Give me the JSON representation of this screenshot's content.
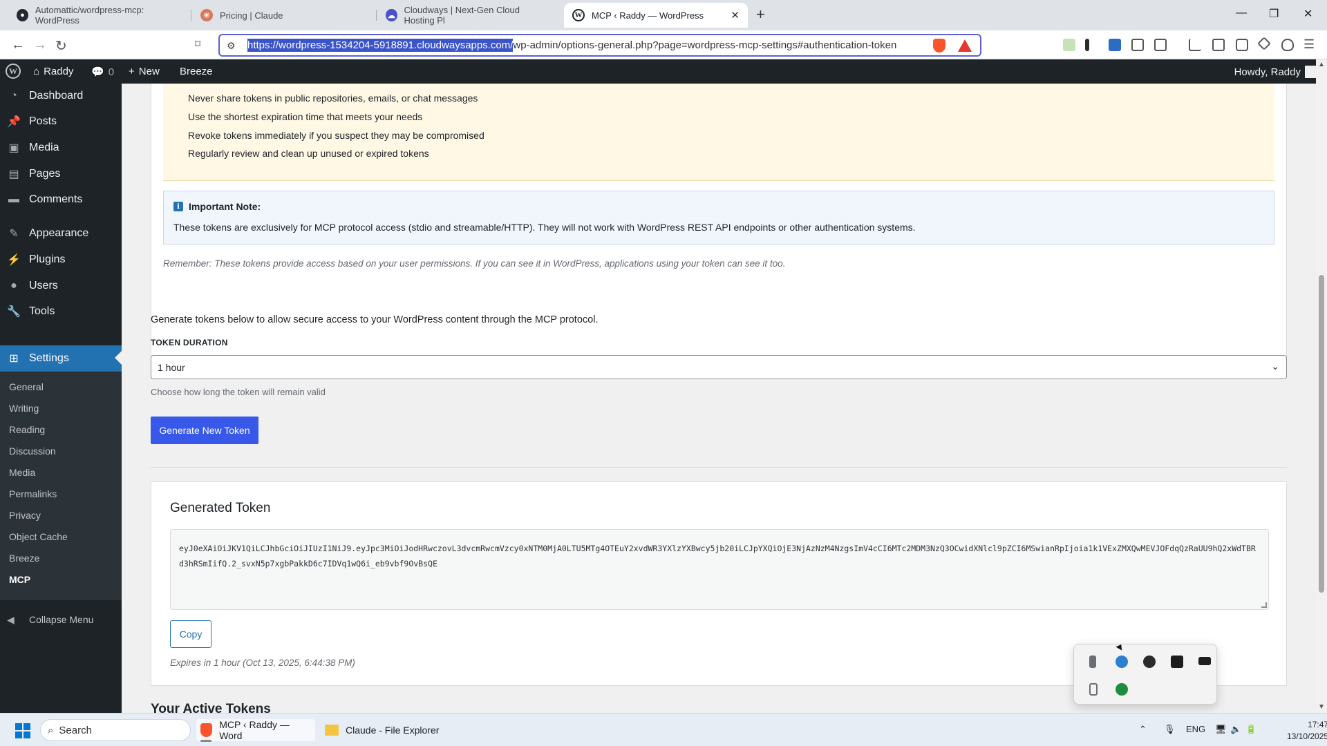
{
  "browser": {
    "tabs": [
      {
        "label": "Automattic/wordpress-mcp: WordPress",
        "icon": "github-icon",
        "active": false
      },
      {
        "label": "Pricing | Claude",
        "icon": "claude-icon",
        "active": false
      },
      {
        "label": "Cloudways | Next-Gen Cloud Hosting Pl",
        "icon": "cloudways-icon",
        "active": false
      },
      {
        "label": "MCP ‹ Raddy — WordPress",
        "icon": "wordpress-icon",
        "active": true
      }
    ],
    "url_host": "https://wordpress-1534204-5918891.cloudwaysapps.com/",
    "url_rest": "wp-admin/options-general.php?page=wordpress-mcp-settings#authentication-token"
  },
  "adminbar": {
    "site_name": "Raddy",
    "comments_count": "0",
    "new_label": "New",
    "breeze_label": "Breeze",
    "howdy": "Howdy, Raddy"
  },
  "sidebar": {
    "items": [
      {
        "label": "Dashboard",
        "icon": "dashboard-icon"
      },
      {
        "label": "Posts",
        "icon": "pin-icon"
      },
      {
        "label": "Media",
        "icon": "media-icon"
      },
      {
        "label": "Pages",
        "icon": "pages-icon"
      },
      {
        "label": "Comments",
        "icon": "comments-icon"
      },
      {
        "label": "Appearance",
        "icon": "brush-icon"
      },
      {
        "label": "Plugins",
        "icon": "plug-icon"
      },
      {
        "label": "Users",
        "icon": "user-icon"
      },
      {
        "label": "Tools",
        "icon": "wrench-icon"
      },
      {
        "label": "Settings",
        "icon": "settings-icon"
      }
    ],
    "submenu": [
      "General",
      "Writing",
      "Reading",
      "Discussion",
      "Media",
      "Permalinks",
      "Privacy",
      "Object Cache",
      "Breeze",
      "MCP"
    ],
    "collapse_label": "Collapse Menu"
  },
  "security": {
    "tips": [
      "Never share tokens in public repositories, emails, or chat messages",
      "Use the shortest expiration time that meets your needs",
      "Revoke tokens immediately if you suspect they may be compromised",
      "Regularly review and clean up unused or expired tokens"
    ],
    "note_title": "Important Note:",
    "note_text": "These tokens are exclusively for MCP protocol access (stdio and streamable/HTTP). They will not work with WordPress REST API endpoints or other authentication systems.",
    "remember": "Remember: These tokens provide access based on your user permissions. If you can see it in WordPress, applications using your token can see it too."
  },
  "generator": {
    "description": "Generate tokens below to allow secure access to your WordPress content through the MCP protocol.",
    "duration_label": "TOKEN DURATION",
    "duration_value": "1 hour",
    "hint": "Choose how long the token will remain valid",
    "button": "Generate New Token"
  },
  "generated": {
    "title": "Generated Token",
    "token": "eyJ0eXAiOiJKV1QiLCJhbGciOiJIUzI1NiJ9.eyJpc3MiOiJodHRwczovL3dvcmRwcmVzcy0xNTM0MjA0LTU5MTg4OTEuY2xvdWR3YXlzYXBwcy5jb20iLCJpYXQiOjE3NjAzNzM4NzgsImV4cCI6MTc2MDM3NzQ3OCwidXNlcl9pZCI6MSwianRpIjoia1k1VExZMXQwMEVJOFdqQzRaUU9hQ2xWdTBRd3hRSmIifQ.2_svxN5p7xgbPakkD6c7IDVq1wQ6i_eb9vbf9OvBsQE",
    "copy_label": "Copy",
    "expires": "Expires in 1 hour (Oct 13, 2025, 6:44:38 PM)"
  },
  "active_tokens_heading": "Your Active Tokens",
  "taskbar": {
    "search_placeholder": "Search",
    "apps": [
      {
        "label": "MCP ‹ Raddy — Word",
        "icon": "brave-icon"
      },
      {
        "label": "Claude - File Explorer",
        "icon": "folder-icon"
      }
    ],
    "language": "ENG",
    "time": "17:47",
    "date": "13/10/2025"
  },
  "colors": {
    "admin_dark": "#1d2327",
    "wp_blue": "#2271b1",
    "primary_button": "#3858e9",
    "warning_bg": "#fff8e5",
    "info_bg": "#f0f6fc"
  }
}
